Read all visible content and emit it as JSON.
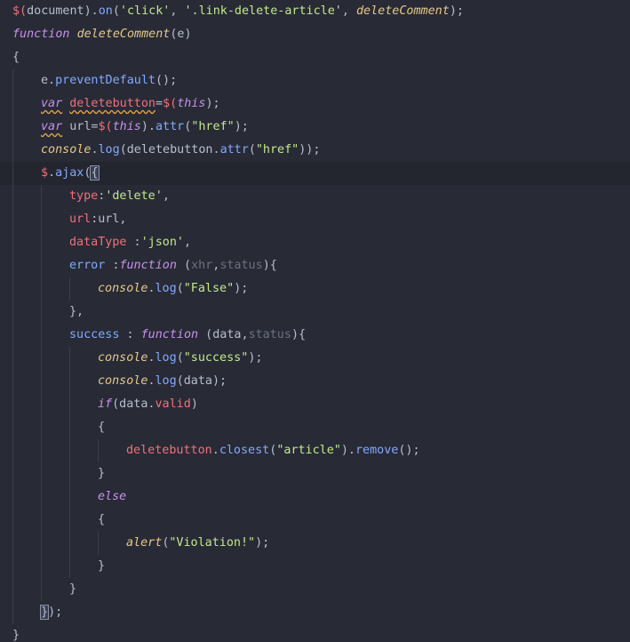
{
  "colors": {
    "background": "#282a36",
    "current_line": "#23252f",
    "method": "#82aaff",
    "keyword": "#c792ea",
    "italic_function": "#e6c98a",
    "property": "#f07178",
    "string": "#c3e88d",
    "dimmed_param": "#6b7180",
    "plain": "#b7bfcc"
  },
  "code": {
    "lines": [
      {
        "indent": 0,
        "tokens": [
          {
            "t": "$(",
            "c": "prop"
          },
          {
            "t": "document",
            "c": "punc"
          },
          {
            "t": ").",
            "c": "punc"
          },
          {
            "t": "on",
            "c": "method"
          },
          {
            "t": "(",
            "c": "punc"
          },
          {
            "t": "'click'",
            "c": "string"
          },
          {
            "t": ", ",
            "c": "punc"
          },
          {
            "t": "'.link-delete-article'",
            "c": "string"
          },
          {
            "t": ", ",
            "c": "punc"
          },
          {
            "t": "deleteComment",
            "c": "italic-fn"
          },
          {
            "t": ");",
            "c": "punc"
          }
        ]
      },
      {
        "indent": 0,
        "tokens": [
          {
            "t": "function",
            "c": "keyword"
          },
          {
            "t": " ",
            "c": "punc"
          },
          {
            "t": "deleteComment",
            "c": "italic-fn"
          },
          {
            "t": "(e)",
            "c": "punc"
          }
        ]
      },
      {
        "indent": 0,
        "tokens": [
          {
            "t": "{",
            "c": "punc"
          }
        ]
      },
      {
        "indent": 1,
        "tokens": [
          {
            "t": "e.",
            "c": "punc"
          },
          {
            "t": "preventDefault",
            "c": "method"
          },
          {
            "t": "();",
            "c": "punc"
          }
        ]
      },
      {
        "indent": 1,
        "tokens": [
          {
            "t": "var",
            "c": "keyword",
            "s": true
          },
          {
            "t": " ",
            "c": "punc"
          },
          {
            "t": "deletebutton",
            "c": "prop",
            "s": true
          },
          {
            "t": "=",
            "c": "punc"
          },
          {
            "t": "$(",
            "c": "prop"
          },
          {
            "t": "this",
            "c": "keyword"
          },
          {
            "t": ");",
            "c": "punc"
          }
        ]
      },
      {
        "indent": 1,
        "tokens": [
          {
            "t": "var",
            "c": "keyword",
            "s": true
          },
          {
            "t": " url=",
            "c": "punc"
          },
          {
            "t": "$(",
            "c": "prop"
          },
          {
            "t": "this",
            "c": "keyword"
          },
          {
            "t": ").",
            "c": "punc"
          },
          {
            "t": "attr",
            "c": "method"
          },
          {
            "t": "(",
            "c": "punc"
          },
          {
            "t": "\"href\"",
            "c": "string"
          },
          {
            "t": ");",
            "c": "punc"
          }
        ]
      },
      {
        "indent": 1,
        "tokens": [
          {
            "t": "console",
            "c": "italic-fn"
          },
          {
            "t": ".",
            "c": "punc"
          },
          {
            "t": "log",
            "c": "method"
          },
          {
            "t": "(deletebutton.",
            "c": "punc"
          },
          {
            "t": "attr",
            "c": "method"
          },
          {
            "t": "(",
            "c": "punc"
          },
          {
            "t": "\"href\"",
            "c": "string"
          },
          {
            "t": "));",
            "c": "punc"
          }
        ]
      },
      {
        "indent": 1,
        "current": true,
        "tokens": [
          {
            "t": "$",
            "c": "prop"
          },
          {
            "t": ".",
            "c": "punc"
          },
          {
            "t": "ajax",
            "c": "method"
          },
          {
            "t": "(",
            "c": "punc"
          },
          {
            "t": "{",
            "c": "punc",
            "cursor": true
          }
        ]
      },
      {
        "indent": 2,
        "tokens": [
          {
            "t": "type",
            "c": "prop"
          },
          {
            "t": ":",
            "c": "punc"
          },
          {
            "t": "'delete'",
            "c": "string"
          },
          {
            "t": ",",
            "c": "punc"
          }
        ]
      },
      {
        "indent": 2,
        "tokens": [
          {
            "t": "url",
            "c": "prop"
          },
          {
            "t": ":url,",
            "c": "punc"
          }
        ]
      },
      {
        "indent": 2,
        "tokens": [
          {
            "t": "dataType",
            "c": "prop"
          },
          {
            "t": " :",
            "c": "punc"
          },
          {
            "t": "'json'",
            "c": "string"
          },
          {
            "t": ",",
            "c": "punc"
          }
        ]
      },
      {
        "indent": 2,
        "tokens": [
          {
            "t": "error",
            "c": "method"
          },
          {
            "t": " :",
            "c": "punc"
          },
          {
            "t": "function",
            "c": "keyword"
          },
          {
            "t": " (",
            "c": "punc"
          },
          {
            "t": "xhr",
            "c": "dim"
          },
          {
            "t": ",",
            "c": "punc"
          },
          {
            "t": "status",
            "c": "dim"
          },
          {
            "t": "){",
            "c": "punc"
          }
        ]
      },
      {
        "indent": 3,
        "tokens": [
          {
            "t": "console",
            "c": "italic-fn"
          },
          {
            "t": ".",
            "c": "punc"
          },
          {
            "t": "log",
            "c": "method"
          },
          {
            "t": "(",
            "c": "punc"
          },
          {
            "t": "\"False\"",
            "c": "string"
          },
          {
            "t": ");",
            "c": "punc"
          }
        ]
      },
      {
        "indent": 2,
        "tokens": [
          {
            "t": "},",
            "c": "punc"
          }
        ]
      },
      {
        "indent": 2,
        "tokens": [
          {
            "t": "success",
            "c": "method"
          },
          {
            "t": " : ",
            "c": "punc"
          },
          {
            "t": "function",
            "c": "keyword"
          },
          {
            "t": " (data,",
            "c": "punc"
          },
          {
            "t": "status",
            "c": "dim"
          },
          {
            "t": "){",
            "c": "punc"
          }
        ]
      },
      {
        "indent": 3,
        "tokens": [
          {
            "t": "console",
            "c": "italic-fn"
          },
          {
            "t": ".",
            "c": "punc"
          },
          {
            "t": "log",
            "c": "method"
          },
          {
            "t": "(",
            "c": "punc"
          },
          {
            "t": "\"success\"",
            "c": "string"
          },
          {
            "t": ");",
            "c": "punc"
          }
        ]
      },
      {
        "indent": 3,
        "tokens": [
          {
            "t": "console",
            "c": "italic-fn"
          },
          {
            "t": ".",
            "c": "punc"
          },
          {
            "t": "log",
            "c": "method"
          },
          {
            "t": "(data);",
            "c": "punc"
          }
        ]
      },
      {
        "indent": 3,
        "tokens": [
          {
            "t": "if",
            "c": "keyword"
          },
          {
            "t": "(data.",
            "c": "punc"
          },
          {
            "t": "valid",
            "c": "prop"
          },
          {
            "t": ")",
            "c": "punc"
          }
        ]
      },
      {
        "indent": 3,
        "tokens": [
          {
            "t": "{",
            "c": "punc"
          }
        ]
      },
      {
        "indent": 4,
        "tokens": [
          {
            "t": "deletebutton",
            "c": "prop"
          },
          {
            "t": ".",
            "c": "punc"
          },
          {
            "t": "closest",
            "c": "method"
          },
          {
            "t": "(",
            "c": "punc"
          },
          {
            "t": "\"article\"",
            "c": "string"
          },
          {
            "t": ").",
            "c": "punc"
          },
          {
            "t": "remove",
            "c": "method"
          },
          {
            "t": "();",
            "c": "punc"
          }
        ]
      },
      {
        "indent": 3,
        "tokens": [
          {
            "t": "}",
            "c": "punc"
          }
        ]
      },
      {
        "indent": 3,
        "tokens": [
          {
            "t": "else",
            "c": "keyword"
          }
        ]
      },
      {
        "indent": 3,
        "tokens": [
          {
            "t": "{",
            "c": "punc"
          }
        ]
      },
      {
        "indent": 4,
        "tokens": [
          {
            "t": "alert",
            "c": "italic-fn"
          },
          {
            "t": "(",
            "c": "punc"
          },
          {
            "t": "\"Violation!\"",
            "c": "string"
          },
          {
            "t": ");",
            "c": "punc"
          }
        ]
      },
      {
        "indent": 3,
        "tokens": [
          {
            "t": "}",
            "c": "punc"
          }
        ]
      },
      {
        "indent": 2,
        "tokens": [
          {
            "t": "}",
            "c": "punc"
          }
        ]
      },
      {
        "indent": 1,
        "tokens": [
          {
            "t": "}",
            "c": "punc",
            "cursor": true
          },
          {
            "t": ");",
            "c": "punc"
          }
        ]
      },
      {
        "indent": 0,
        "tokens": [
          {
            "t": "}",
            "c": "punc"
          }
        ]
      }
    ]
  }
}
